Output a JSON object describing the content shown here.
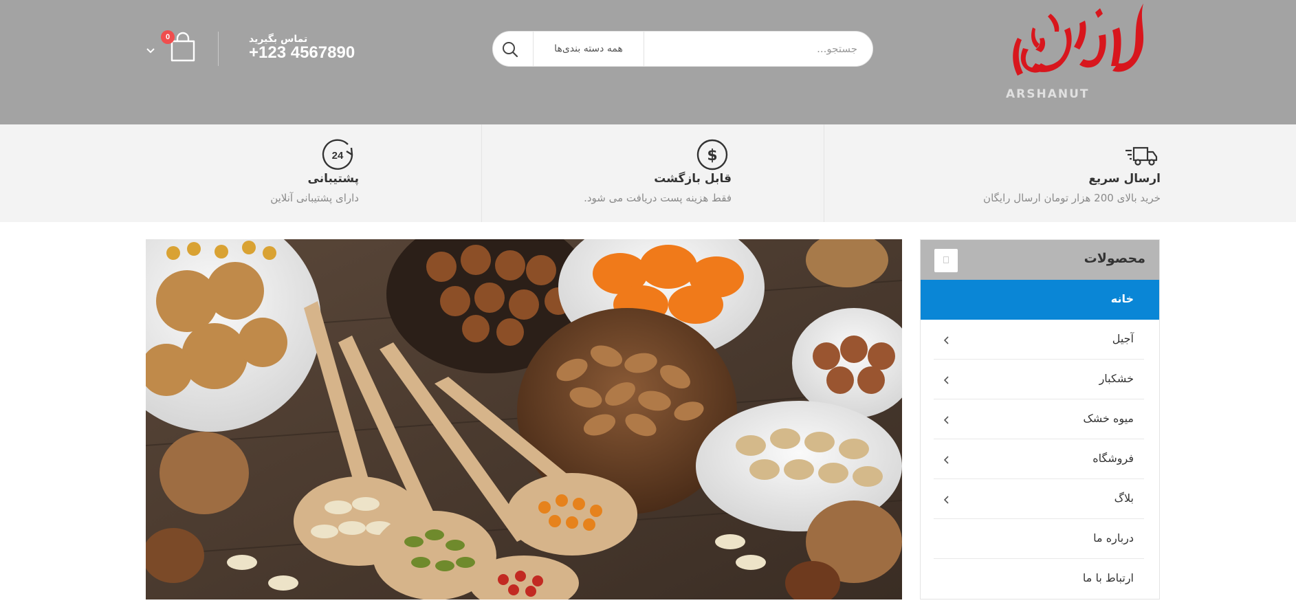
{
  "header": {
    "logo_text": "آرشانات",
    "logo_sub": "ARSHANUT",
    "search": {
      "placeholder": "جستجو...",
      "category": "همه دسته بندی‌ها"
    },
    "contact_label": "تماس بگیرید",
    "contact_phone": "+123 4567890",
    "cart_count": "0",
    "colors": {
      "header_bg": "#a3a3a3",
      "logo_red": "#d8161d",
      "badge": "#f04e4e"
    }
  },
  "features": [
    {
      "icon": "truck-icon",
      "title": "ارسال سریع",
      "desc": "خرید بالای 200 هزار تومان ارسال رایگان"
    },
    {
      "icon": "dollar-icon",
      "title": "قابل بازگشت",
      "desc": "فقط هزینه پست دریافت می شود."
    },
    {
      "icon": "support-24-icon",
      "title": "پشتیبانی",
      "desc": "دارای پشتیبانی آنلاین",
      "icon_text": "24"
    }
  ],
  "sidebar": {
    "title": "محصولات",
    "items": [
      {
        "label": "خانه",
        "active": true,
        "has_submenu": false
      },
      {
        "label": "آجیل",
        "active": false,
        "has_submenu": true
      },
      {
        "label": "خشکبار",
        "active": false,
        "has_submenu": true
      },
      {
        "label": "میوه خشک",
        "active": false,
        "has_submenu": true
      },
      {
        "label": "فروشگاه",
        "active": false,
        "has_submenu": true
      },
      {
        "label": "بلاگ",
        "active": false,
        "has_submenu": true
      },
      {
        "label": "درباره ما",
        "active": false,
        "has_submenu": false
      },
      {
        "label": "ارتباط با ما",
        "active": false,
        "has_submenu": false
      }
    ],
    "accent": "#0a86d6"
  },
  "hero": {
    "image": "dried-fruits-and-nuts-banner"
  }
}
